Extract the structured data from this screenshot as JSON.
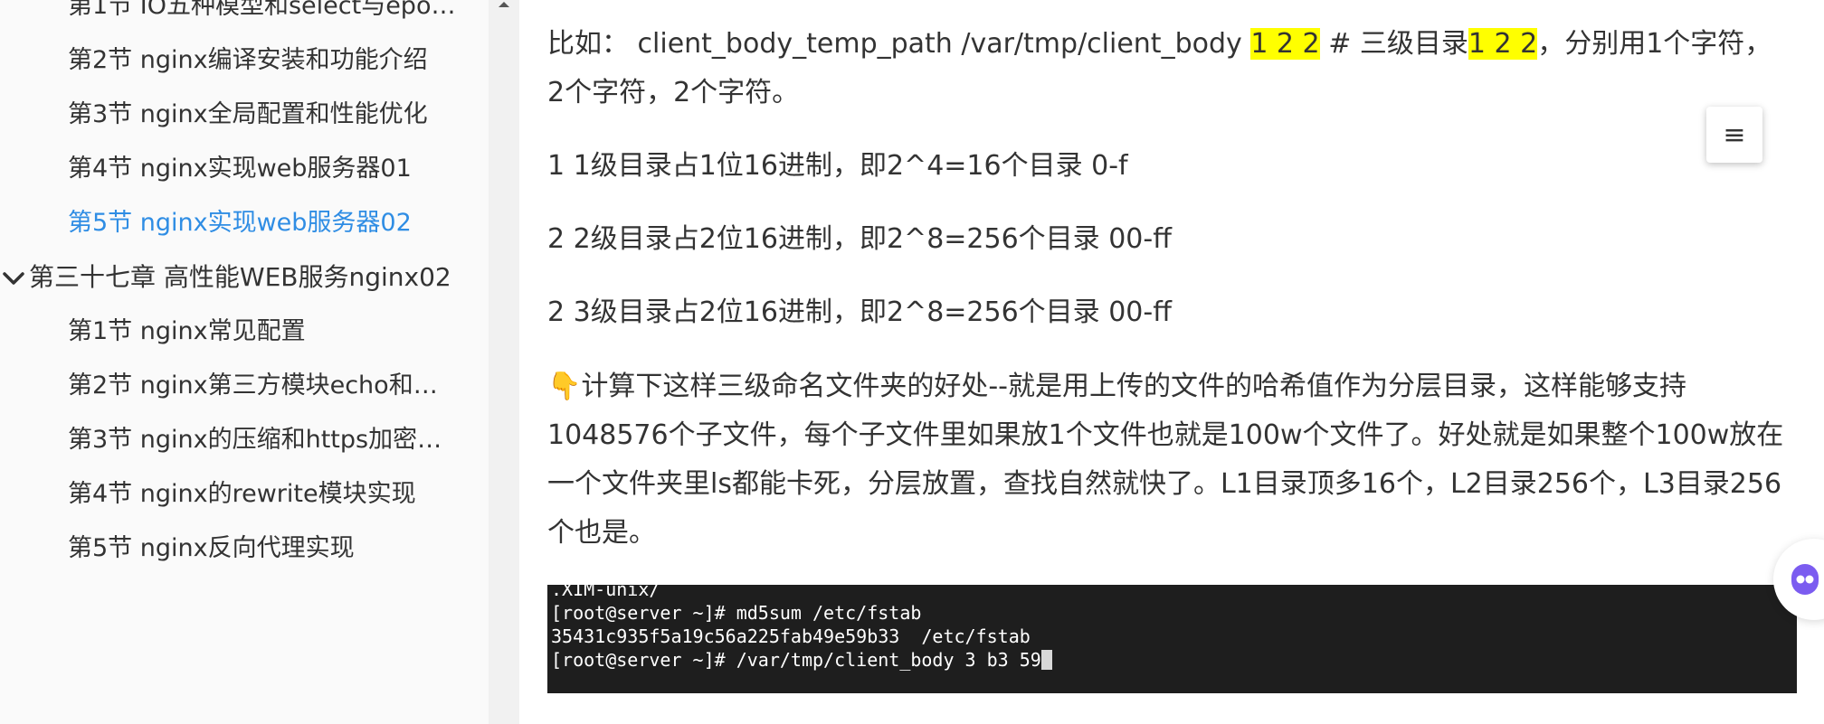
{
  "sidebar": {
    "items": [
      {
        "label": "第1节 IO五种模型和select与epo…",
        "active": false
      },
      {
        "label": "第2节 nginx编译安装和功能介绍",
        "active": false
      },
      {
        "label": "第3节 nginx全局配置和性能优化",
        "active": false
      },
      {
        "label": "第4节 nginx实现web服务器01",
        "active": false
      },
      {
        "label": "第5节 nginx实现web服务器02",
        "active": true
      }
    ],
    "chapter": {
      "label": "第三十七章 高性能WEB服务nginx02",
      "icon": "chevron-down-icon"
    },
    "chapter_items": [
      {
        "label": "第1节 nginx常见配置"
      },
      {
        "label": "第2节 nginx第三方模块echo和…"
      },
      {
        "label": "第3节 nginx的压缩和https加密…"
      },
      {
        "label": "第4节 nginx的rewrite模块实现"
      },
      {
        "label": "第5节 nginx反向代理实现"
      }
    ]
  },
  "content": {
    "p1": {
      "prefix": "比如：  client_body_temp_path /var/tmp/client_body ",
      "hl1": "1 2 2",
      "mid": " # 三级目录",
      "hl2": "1 2 2",
      "suffix": "，分别用1个字符，2个字符，2个字符。"
    },
    "p2": "1 1级目录占1位16进制，即2^4=16个目录 0-f",
    "p3": "2 2级目录占2位16进制，即2^8=256个目录 00-ff",
    "p4": "2 3级目录占2位16进制，即2^8=256个目录 00-ff",
    "p5": {
      "emoji": "👇",
      "text": "计算下这样三级命名文件夹的好处--就是用上传的文件的哈希值作为分层目录，这样能够支持1048576个子文件，每个子文件里如果放1个文件也就是100w个文件了。好处就是如果整个100w放在一个文件夹里ls都能卡死，分层放置，查找自然就快了。L1目录顶多16个，L2目录256个，L3目录256个也是。"
    }
  },
  "terminal": {
    "lines": [
      ".XIM-unix/",
      "[root@server ~]# md5sum /etc/fstab",
      "35431c935f5a19c56a225fab49e59b33  /etc/fstab",
      "[root@server ~]# /var/tmp/client_body 3 b3 59"
    ]
  },
  "toc_button": {
    "icon": "menu-icon",
    "glyph": "≡"
  },
  "colors": {
    "active_link": "#2f8de4",
    "highlight": "#ffff00",
    "terminal_bg": "#1e1e1e",
    "sidebar_bg": "#fafafa",
    "assistant_accent": "#7b5cf0"
  }
}
